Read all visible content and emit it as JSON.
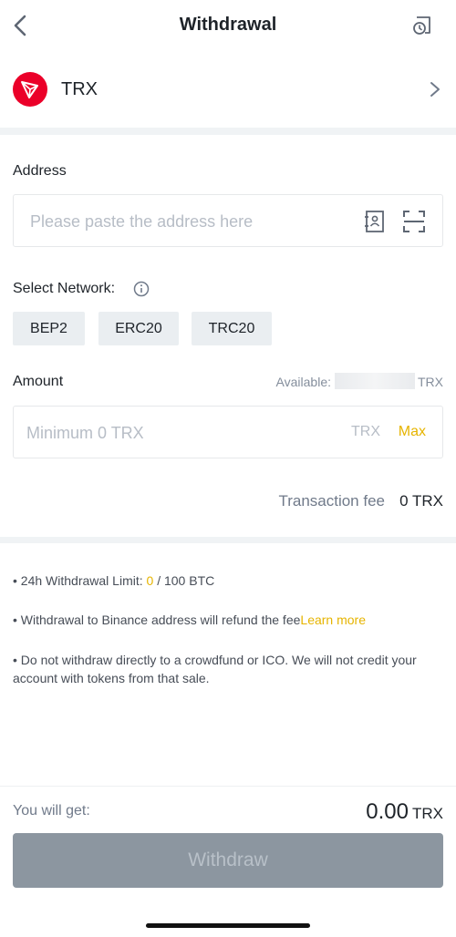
{
  "header": {
    "title": "Withdrawal",
    "back_icon": "chevron-left-icon",
    "history_icon": "history-icon"
  },
  "coin": {
    "name": "TRX",
    "logo_icon": "tron-logo-icon",
    "logo_color": "#eb0029"
  },
  "address": {
    "label": "Address",
    "placeholder": "Please paste the address here",
    "value": ""
  },
  "network": {
    "label": "Select Network:",
    "options": [
      "BEP2",
      "ERC20",
      "TRC20"
    ]
  },
  "amount": {
    "label": "Amount",
    "available_label": "Available:",
    "available_unit": "TRX",
    "placeholder": "Minimum 0 TRX",
    "unit": "TRX",
    "max_label": "Max"
  },
  "fee": {
    "label": "Transaction fee",
    "value": "0 TRX"
  },
  "notes": {
    "limit_prefix": "• 24h Withdrawal Limit: ",
    "limit_used": "0",
    "limit_suffix": " / 100 BTC",
    "refund_text": "• Withdrawal to Binance address will refund the fee",
    "learn_more": "Learn more",
    "warning": "• Do not withdraw directly to a crowdfund or ICO. We will not credit your account with tokens from that sale."
  },
  "footer": {
    "get_label": "You will get:",
    "get_amount": "0.00",
    "get_unit": "TRX",
    "withdraw_label": "Withdraw"
  },
  "colors": {
    "accent": "#e6b400",
    "button_disabled": "#8c96a0",
    "divider": "#f0f3f5"
  }
}
